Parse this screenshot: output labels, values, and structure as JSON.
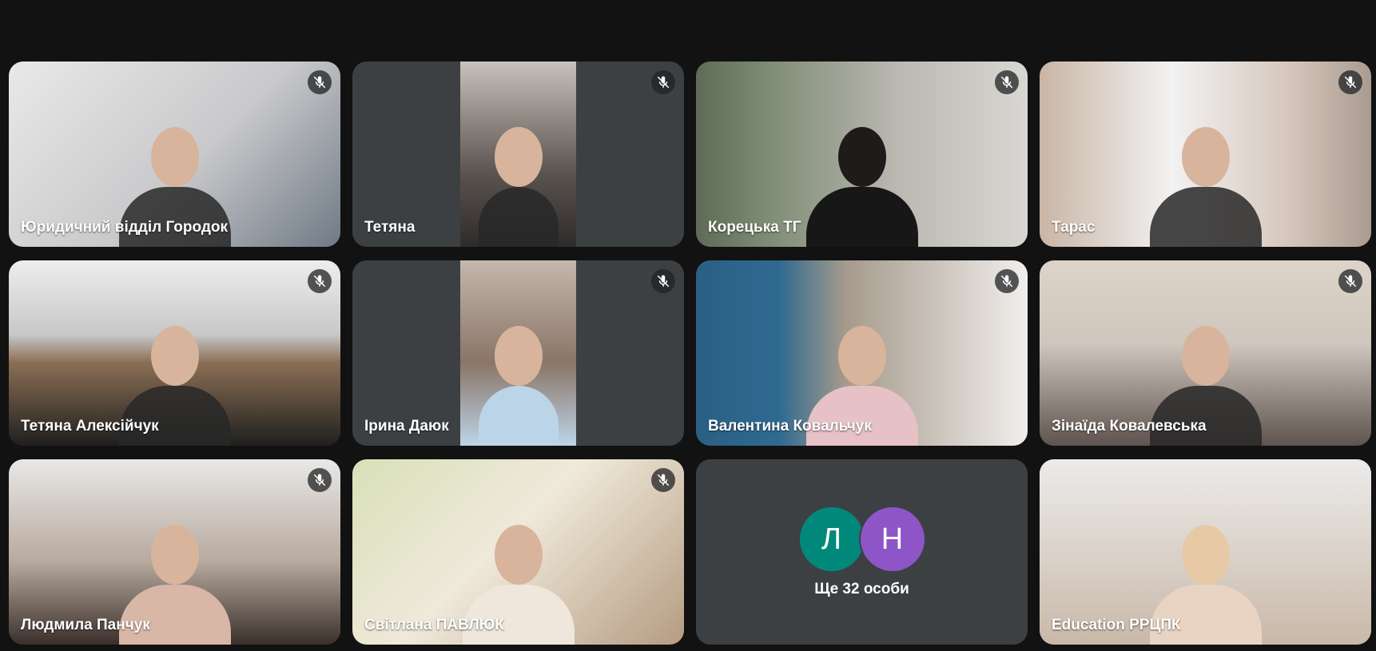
{
  "tiles": [
    {
      "name": "Юридичний відділ Городок",
      "muted": true
    },
    {
      "name": "Тетяна",
      "muted": true
    },
    {
      "name": "Корецька ТГ",
      "muted": true
    },
    {
      "name": "Тарас",
      "muted": true
    },
    {
      "name": "Тетяна Алексійчук",
      "muted": true
    },
    {
      "name": "Ірина Даюк",
      "muted": true
    },
    {
      "name": "Валентина Ковальчук",
      "muted": true
    },
    {
      "name": "Зінаїда Ковалевська",
      "muted": true
    },
    {
      "name": "Людмила Панчук",
      "muted": true
    },
    {
      "name": "Світлана ПАВЛЮК",
      "muted": true
    },
    {
      "name": "Education РРЦПК",
      "muted": false
    }
  ],
  "others": {
    "avatars": [
      {
        "letter": "Л",
        "color": "#00897b"
      },
      {
        "letter": "Н",
        "color": "#8e55c7"
      }
    ],
    "label": "Ще 32 особи"
  },
  "colors": {
    "background": "#121212",
    "tile_background": "#3c4043",
    "active_speaker_border": "#a8c7fa"
  }
}
